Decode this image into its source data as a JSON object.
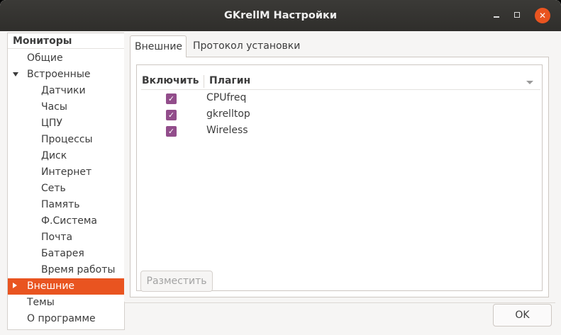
{
  "window": {
    "title": "GKrellM Настройки"
  },
  "tree": {
    "header": "Мониторы",
    "items": [
      {
        "label": "Общие",
        "level": 0,
        "expander": "none",
        "selected": false
      },
      {
        "label": "Встроенные",
        "level": 0,
        "expander": "expanded",
        "selected": false
      },
      {
        "label": "Датчики",
        "level": 1,
        "expander": "none",
        "selected": false
      },
      {
        "label": "Часы",
        "level": 1,
        "expander": "none",
        "selected": false
      },
      {
        "label": "ЦПУ",
        "level": 1,
        "expander": "none",
        "selected": false
      },
      {
        "label": "Процессы",
        "level": 1,
        "expander": "none",
        "selected": false
      },
      {
        "label": "Диск",
        "level": 1,
        "expander": "none",
        "selected": false
      },
      {
        "label": "Интернет",
        "level": 1,
        "expander": "none",
        "selected": false
      },
      {
        "label": "Сеть",
        "level": 1,
        "expander": "none",
        "selected": false
      },
      {
        "label": "Память",
        "level": 1,
        "expander": "none",
        "selected": false
      },
      {
        "label": "Ф.Система",
        "level": 1,
        "expander": "none",
        "selected": false
      },
      {
        "label": "Почта",
        "level": 1,
        "expander": "none",
        "selected": false
      },
      {
        "label": "Батарея",
        "level": 1,
        "expander": "none",
        "selected": false
      },
      {
        "label": "Время работы",
        "level": 1,
        "expander": "none",
        "selected": false
      },
      {
        "label": "Внешние",
        "level": 0,
        "expander": "collapsed",
        "selected": true
      },
      {
        "label": "Темы",
        "level": 0,
        "expander": "none",
        "selected": false
      },
      {
        "label": "О программе",
        "level": 0,
        "expander": "none",
        "selected": false
      }
    ]
  },
  "tabs": [
    {
      "label": "Внешние",
      "active": true
    },
    {
      "label": "Протокол установки",
      "active": false
    }
  ],
  "plugins": {
    "columns": {
      "enable": "Включить",
      "plugin": "Плагин"
    },
    "rows": [
      {
        "name": "CPUfreq",
        "enabled": true
      },
      {
        "name": "gkrelltop",
        "enabled": true
      },
      {
        "name": "Wireless",
        "enabled": true
      }
    ],
    "place_button": "Разместить"
  },
  "ok_button": "OK",
  "colors": {
    "accent": "#e95420",
    "checkbox": "#924d8b",
    "titlebar": "#2f2e2b"
  }
}
